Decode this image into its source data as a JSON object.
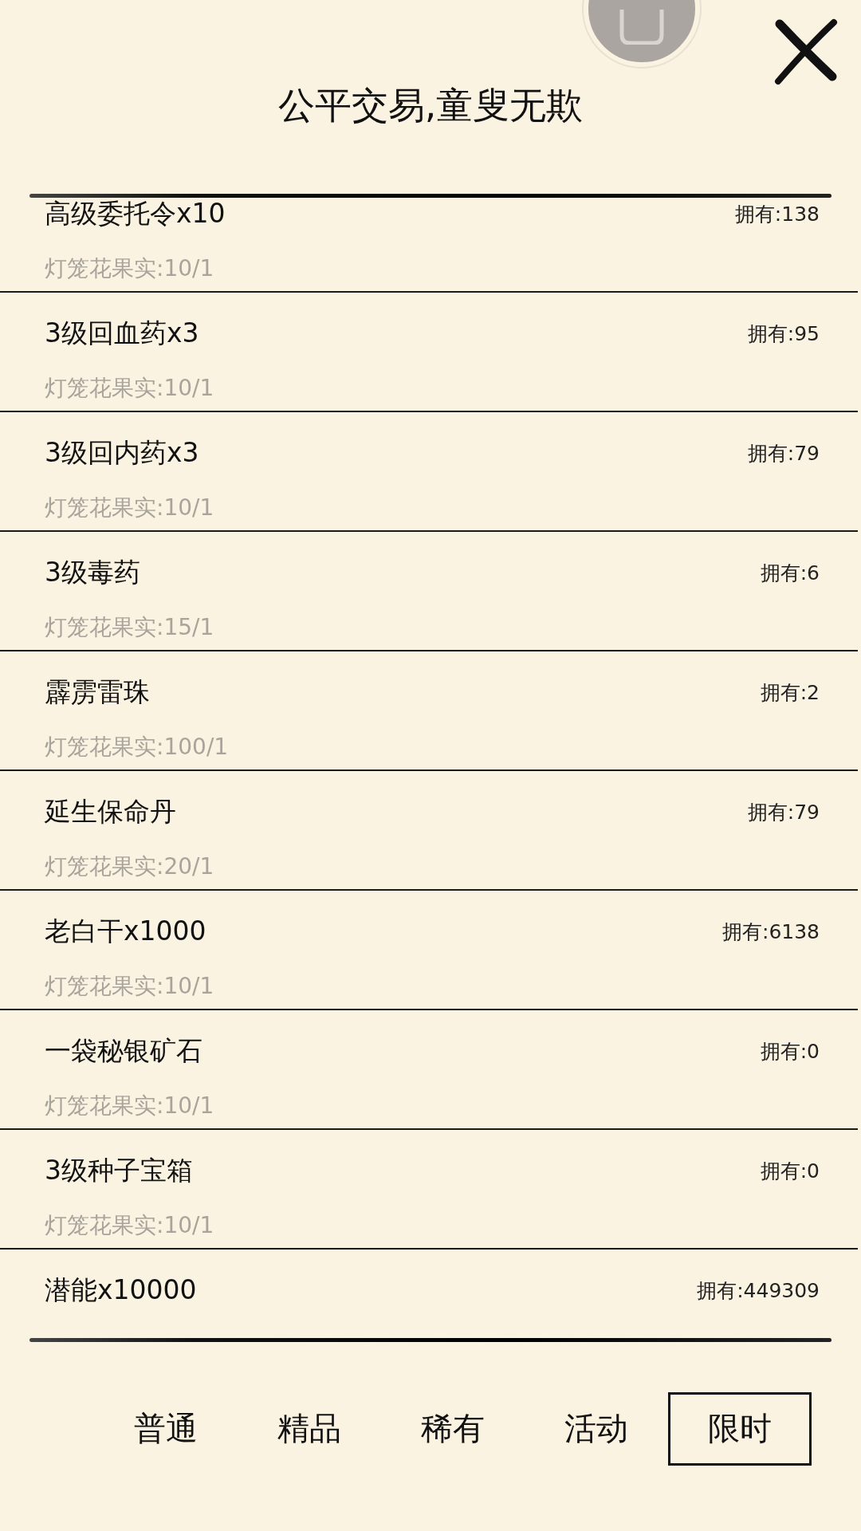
{
  "title": "公平交易,童叟无欺",
  "items": [
    {
      "name": "高级委托令x10",
      "owned": "拥有:138",
      "price": "灯笼花果实:10/1"
    },
    {
      "name": "3级回血药x3",
      "owned": "拥有:95",
      "price": "灯笼花果实:10/1"
    },
    {
      "name": "3级回内药x3",
      "owned": "拥有:79",
      "price": "灯笼花果实:10/1"
    },
    {
      "name": "3级毒药",
      "owned": "拥有:6",
      "price": "灯笼花果实:15/1"
    },
    {
      "name": "霹雳雷珠",
      "owned": "拥有:2",
      "price": "灯笼花果实:100/1"
    },
    {
      "name": "延生保命丹",
      "owned": "拥有:79",
      "price": "灯笼花果实:20/1"
    },
    {
      "name": "老白干x1000",
      "owned": "拥有:6138",
      "price": "灯笼花果实:10/1"
    },
    {
      "name": "一袋秘银矿石",
      "owned": "拥有:0",
      "price": "灯笼花果实:10/1"
    },
    {
      "name": "3级种子宝箱",
      "owned": "拥有:0",
      "price": "灯笼花果实:10/1"
    },
    {
      "name": "潜能x10000",
      "owned": "拥有:449309"
    }
  ],
  "tabs": [
    {
      "label": "普通",
      "selected": false
    },
    {
      "label": "精品",
      "selected": false
    },
    {
      "label": "稀有",
      "selected": false
    },
    {
      "label": "活动",
      "selected": false
    },
    {
      "label": "限时",
      "selected": true
    }
  ]
}
